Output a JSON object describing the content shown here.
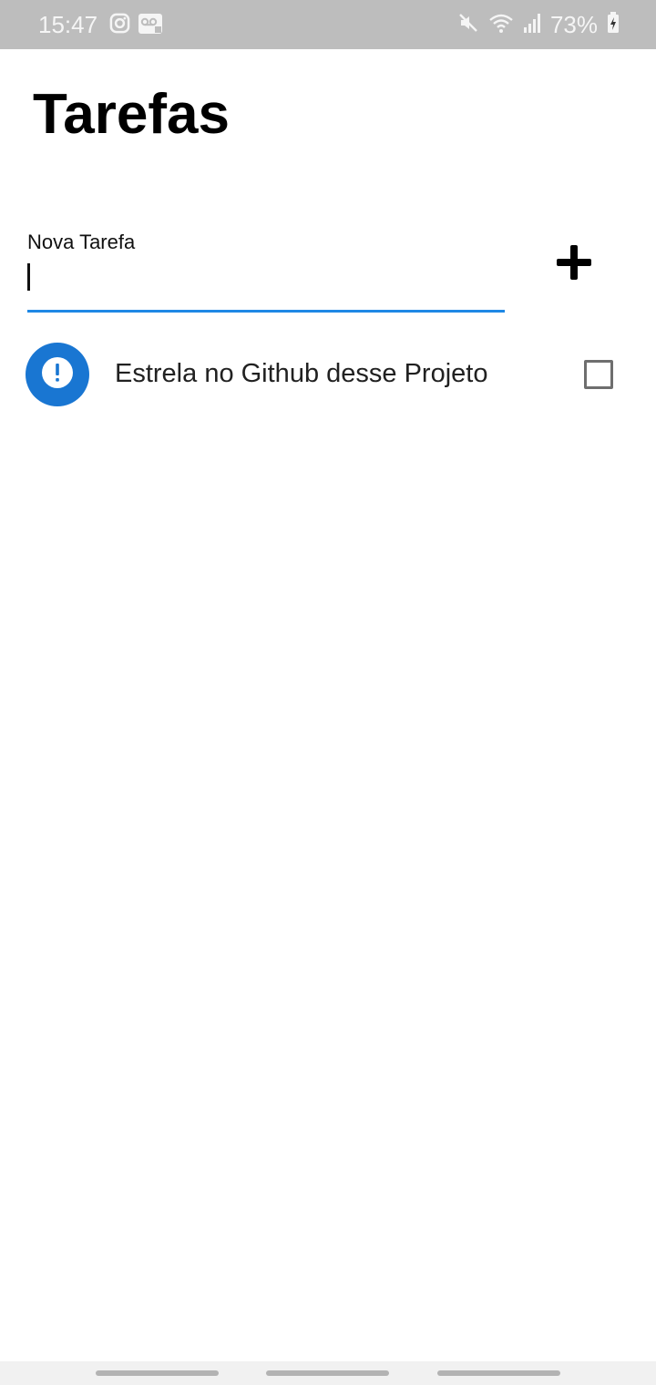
{
  "status_bar": {
    "time": "15:47",
    "battery_percent": "73%",
    "left_icons": [
      "instagram-icon",
      "voicemail-icon"
    ],
    "right_icons": [
      "mute-icon",
      "wifi-icon",
      "signal-icon",
      "battery-charging-icon"
    ]
  },
  "header": {
    "title": "Tarefas"
  },
  "new_task": {
    "label": "Nova Tarefa",
    "value": "",
    "accent_color": "#1e88e5",
    "add_icon": "plus-icon"
  },
  "tasks": [
    {
      "text": "Estrela no Github desse Projeto",
      "icon": "exclamation-icon",
      "icon_color": "#1976d2",
      "done": false
    }
  ],
  "navigation_bar": {
    "handles": 3
  }
}
